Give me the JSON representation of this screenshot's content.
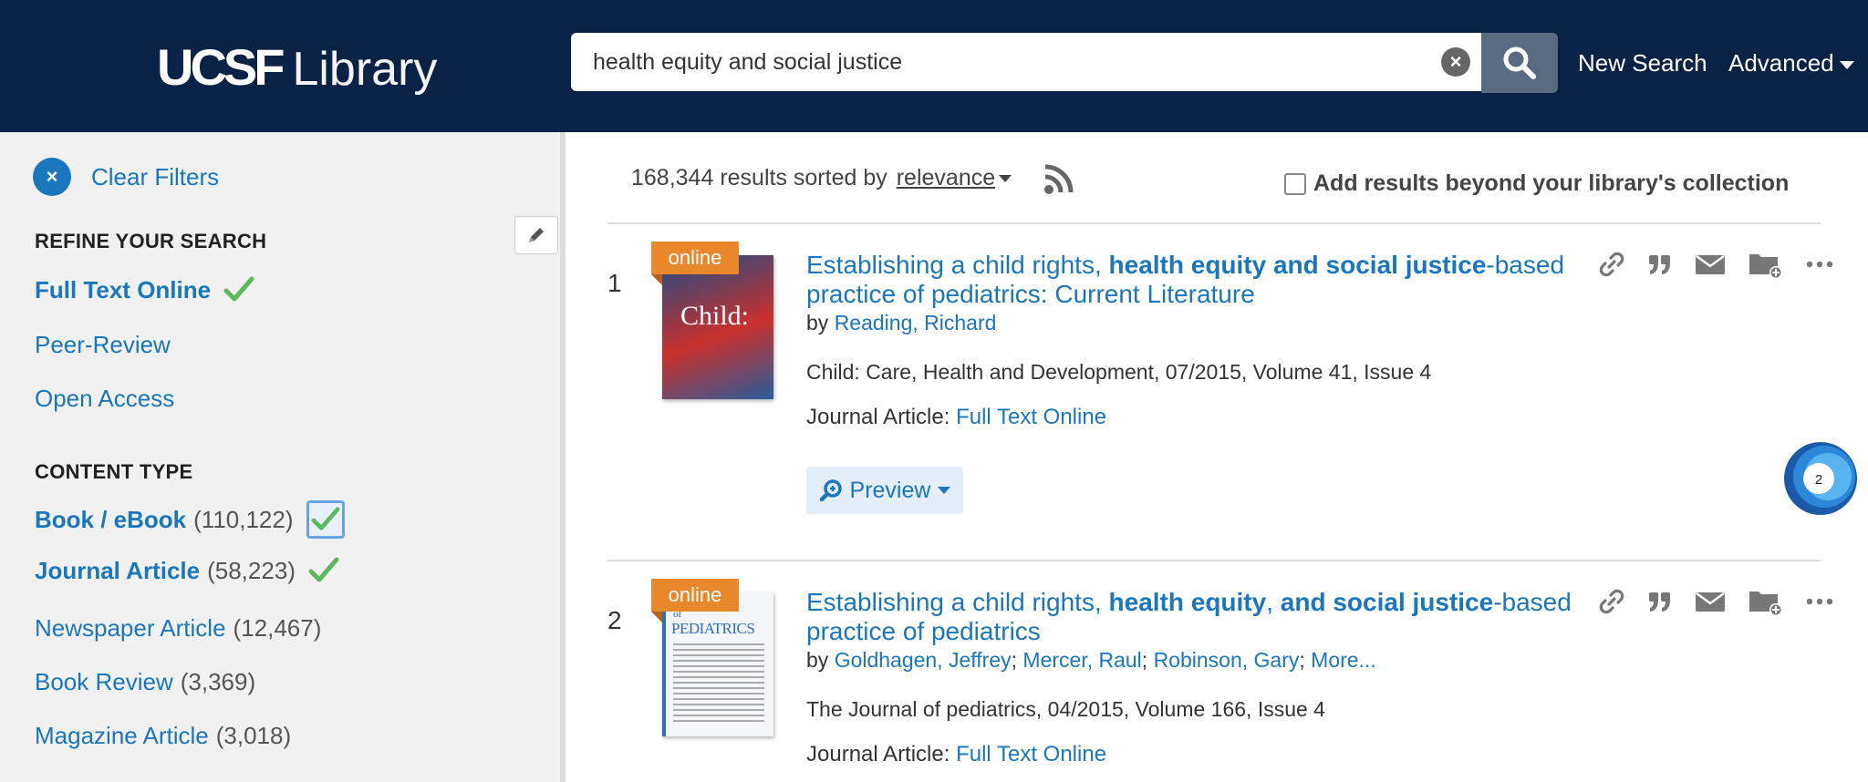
{
  "header": {
    "logo_ucsf": "UCSF",
    "logo_library": "Library",
    "search_value": "health equity and social justice",
    "new_search": "New Search",
    "advanced": "Advanced"
  },
  "sidebar": {
    "clear_filters": "Clear Filters",
    "refine_heading": "REFINE YOUR SEARCH",
    "refine_items": [
      {
        "label": "Full Text Online",
        "checked": true
      },
      {
        "label": "Peer-Review",
        "checked": false
      },
      {
        "label": "Open Access",
        "checked": false
      }
    ],
    "content_type_heading": "CONTENT TYPE",
    "content_types": [
      {
        "label": "Book / eBook",
        "count": "(110,122)",
        "checked": true,
        "focused": true
      },
      {
        "label": "Journal Article",
        "count": "(58,223)",
        "checked": true
      },
      {
        "label": "Newspaper Article",
        "count": "(12,467)",
        "checked": false
      },
      {
        "label": "Book Review",
        "count": "(3,369)",
        "checked": false
      },
      {
        "label": "Magazine Article",
        "count": "(3,018)",
        "checked": false
      }
    ]
  },
  "results_bar": {
    "summary": "168,344 results sorted by",
    "sort": "relevance",
    "beyond": "Add results beyond your library's collection"
  },
  "results": [
    {
      "number": "1",
      "badge": "online",
      "title_plain_1": "Establishing a child rights, ",
      "title_bold_1": "health equity and social justice",
      "title_plain_2": "-based practice of pediatrics: Current Literature",
      "by": "by",
      "authors": [
        "Reading, Richard"
      ],
      "source": "Child: Care, Health and Development, 07/2015, Volume 41, Issue 4",
      "format_label": "Journal Article:",
      "format_link": "Full Text Online",
      "preview": "Preview",
      "cover_text": "Child:",
      "altmetric": "2"
    },
    {
      "number": "2",
      "badge": "online",
      "title_plain_1": "Establishing a child rights, ",
      "title_bold_1": "health equity",
      "title_plain_2": ", ",
      "title_bold_2": "and social justice",
      "title_plain_3": "-based practice of pediatrics",
      "by": "by",
      "authors": [
        "Goldhagen, Jeffrey",
        "Mercer, Raul",
        "Robinson, Gary"
      ],
      "more": "More...",
      "source": "The Journal of pediatrics, 04/2015, Volume 166, Issue 4",
      "format_label": "Journal Article:",
      "format_link": "Full Text Online",
      "cover_text": "PEDIATRICS",
      "cover_text_small": "of"
    }
  ],
  "colors": {
    "header_bg": "#0a2245",
    "link": "#1a76bd",
    "online_badge": "#e9872b",
    "check": "#5cb85c"
  }
}
